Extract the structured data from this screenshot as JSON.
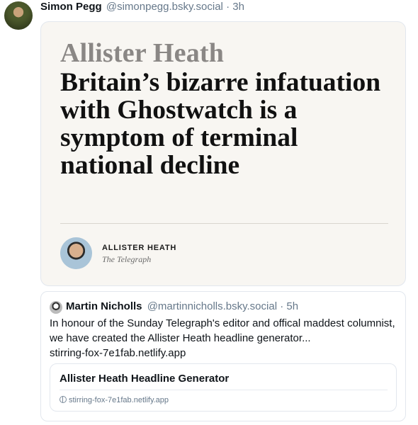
{
  "post": {
    "author_name": "Simon Pegg",
    "author_handle": "@simonpegg.bsky.social",
    "separator": "·",
    "time": "3h",
    "avatar_icon": "user-avatar"
  },
  "image": {
    "kicker": "Allister Heath",
    "headline": "Britain’s bizarre infatuation with Ghostwatch is a symptom of terminal national decline",
    "byline_name": "ALLISTER HEATH",
    "byline_outlet": "The Telegraph"
  },
  "quote": {
    "author_name": "Martin Nicholls",
    "author_handle": "@martinnicholls.bsky.social",
    "separator": "·",
    "time": "5h",
    "text": "In honour of the Sunday Telegraph's editor and offical maddest columnist, we have created the Allister Heath headline generator...",
    "link_text": "stirring-fox-7e1fab.netlify.app"
  },
  "link_card": {
    "title": "Allister Heath Headline Generator",
    "domain": "stirring-fox-7e1fab.netlify.app",
    "icon": "globe-icon"
  }
}
